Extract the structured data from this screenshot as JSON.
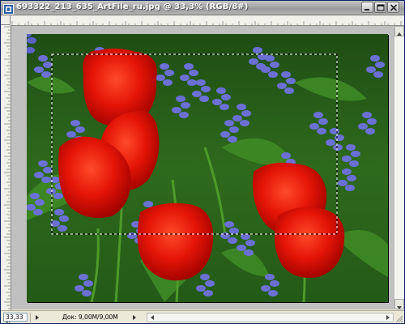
{
  "window": {
    "title": "693322_213_635_ArtFile_ru.jpg @ 33,3% (RGB/8#)"
  },
  "title_buttons": {
    "minimize_icon": "minimize-icon",
    "maximize_icon": "maximize-icon",
    "close_icon": "close-icon"
  },
  "canvas": {
    "description_colors": {
      "background": "#c0c0c0",
      "foliage": "#2f6b1f",
      "tulip": "#e01408",
      "bluebell": "#5a63c8"
    }
  },
  "status": {
    "zoom": "33,33 %",
    "doc_info": "Док: 9,00M/9,00M"
  }
}
